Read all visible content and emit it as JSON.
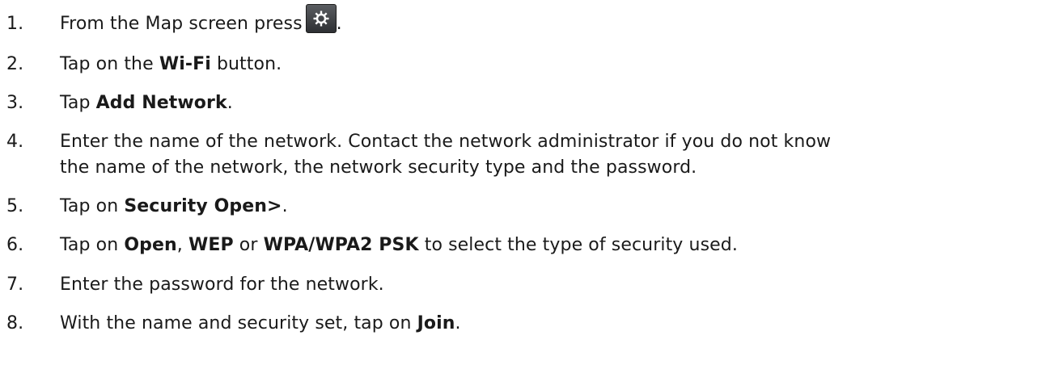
{
  "steps": [
    {
      "number": "1.",
      "parts": [
        "From the Map screen press",
        "."
      ],
      "icon": "gear-icon"
    },
    {
      "number": "2.",
      "parts": [
        "Tap on the ",
        "Wi-Fi",
        " button."
      ]
    },
    {
      "number": "3.",
      "parts": [
        "Tap ",
        "Add Network",
        "."
      ]
    },
    {
      "number": "4.",
      "lines": [
        "Enter the name of the network. Contact the network administrator if you do not know",
        "the name of the network, the network security type and the password."
      ]
    },
    {
      "number": "5.",
      "parts": [
        "Tap on ",
        "Security Open>",
        "."
      ]
    },
    {
      "number": "6.",
      "parts": [
        "Tap on ",
        "Open",
        ", ",
        "WEP",
        " or ",
        "WPA/WPA2 PSK",
        " to select the type of security used."
      ]
    },
    {
      "number": "7.",
      "text": "Enter the password for the network."
    },
    {
      "number": "8.",
      "parts": [
        "With the name and security set, tap on ",
        "Join",
        "."
      ]
    }
  ]
}
